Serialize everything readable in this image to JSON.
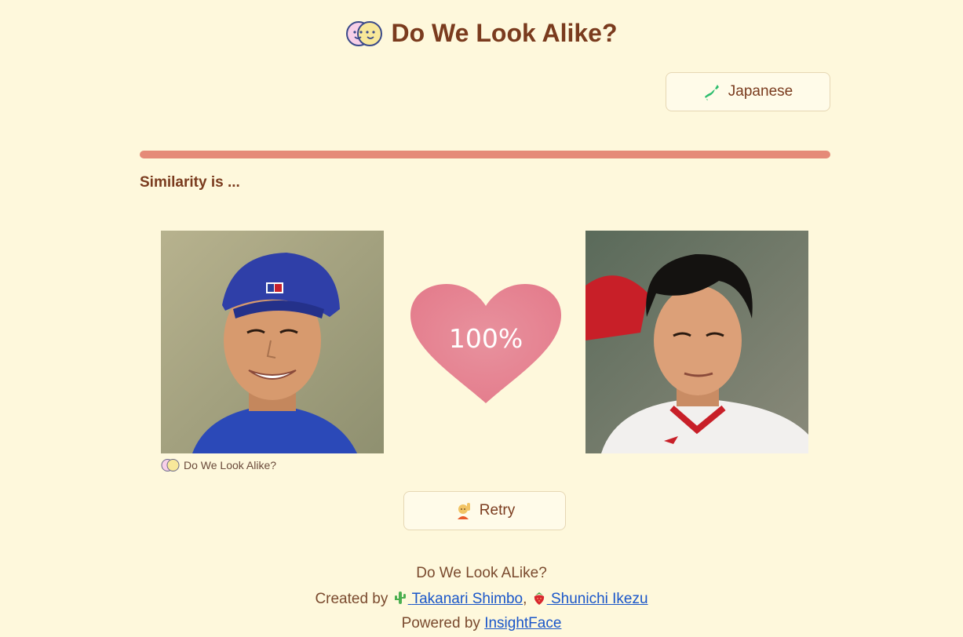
{
  "header": {
    "title": "Do We Look Alike?",
    "icon": "two-faces-icon"
  },
  "language_button": {
    "label": "Japanese",
    "icon": "japan-map-icon"
  },
  "progress": {
    "value_percent": 100,
    "color": "#e58a78"
  },
  "result": {
    "label": "Similarity is ...",
    "score": "100%",
    "heart_color": "#e88896"
  },
  "photos": {
    "left": {
      "description_icon": "person-blue-cap-photo"
    },
    "right": {
      "description_icon": "person-red-shirt-photo"
    },
    "caption": "Do We Look Alike?"
  },
  "retry_button": {
    "label": "Retry",
    "icon": "raising-hand-icon"
  },
  "footer": {
    "line1": "Do We Look ALike?",
    "created_by": "Created by",
    "author1": "Takanari Shimbo",
    "separator": ",",
    "author2": "Shunichi Ikezu",
    "powered_by": "Powered by",
    "powered_link": "InsightFace"
  },
  "colors": {
    "background": "#fef8dc",
    "text": "#7a3b1e",
    "link": "#1a56c9"
  }
}
